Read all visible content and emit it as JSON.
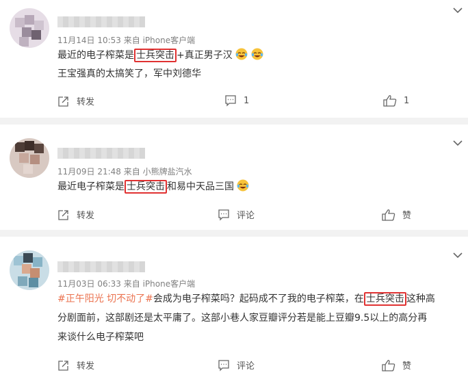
{
  "posts": [
    {
      "meta": "11月14日 10:53  来自 iPhone客户端",
      "line1_prefix": "最近的电子榨菜是",
      "line1_highlight": "士兵突击",
      "line1_suffix": "+真正男子汉",
      "line2": "王宝强真的太搞笑了，军中刘德华",
      "actions": {
        "repost": "转发",
        "comment": "1",
        "like": "1"
      }
    },
    {
      "meta": "11月09日 21:48  来自 小熊牌盐汽水",
      "line1_prefix": "最近电子榨菜是",
      "line1_highlight": "士兵突击",
      "line1_suffix": "和易中天品三国",
      "actions": {
        "repost": "转发",
        "comment": "评论",
        "like": "赞"
      }
    },
    {
      "meta": "11月03日 06:33  来自 iPhone客户端",
      "topic": "#正午阳光 切不动了#",
      "line1_a": "会成为电子榨菜吗？起码成不了我的电子榨菜，在",
      "line1_highlight": "士兵突击",
      "line1_b": "这种高",
      "line2": "分剧面前，这部剧还是太平庸了。这部小巷人家豆瓣评分若是能上豆瓣9.5以上的高分再",
      "line3": "来谈什么电子榨菜吧",
      "actions": {
        "repost": "转发",
        "comment": "评论",
        "like": "赞"
      }
    }
  ],
  "colors": {
    "highlight_box": "#e03131",
    "topic": "#eb7350",
    "divider": "#f2f2f2"
  }
}
